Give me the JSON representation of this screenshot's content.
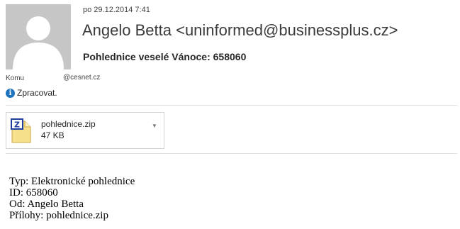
{
  "header": {
    "date": "po 29.12.2014 7:41",
    "sender": "Angelo Betta <uninformed@businessplus.cz>",
    "subject": "Pohlednice veselé Vánoce: 658060",
    "to_label": "Komu",
    "to_value": "@cesnet.cz",
    "info_text": "Zpracovat."
  },
  "attachment": {
    "icon": "zip-file-icon",
    "name": "pohlednice.zip",
    "size": "47 KB"
  },
  "body": {
    "lines": [
      "Typ: Elektronické pohlednice",
      "ID: 658060",
      "Od: Angelo Betta",
      "Přílohy: pohlednice.zip"
    ]
  },
  "colors": {
    "avatar_bg": "#c6c6c6",
    "info_blue": "#1e73be",
    "zip_blue": "#1f3f9f",
    "zip_yellow": "#f7e08b"
  }
}
